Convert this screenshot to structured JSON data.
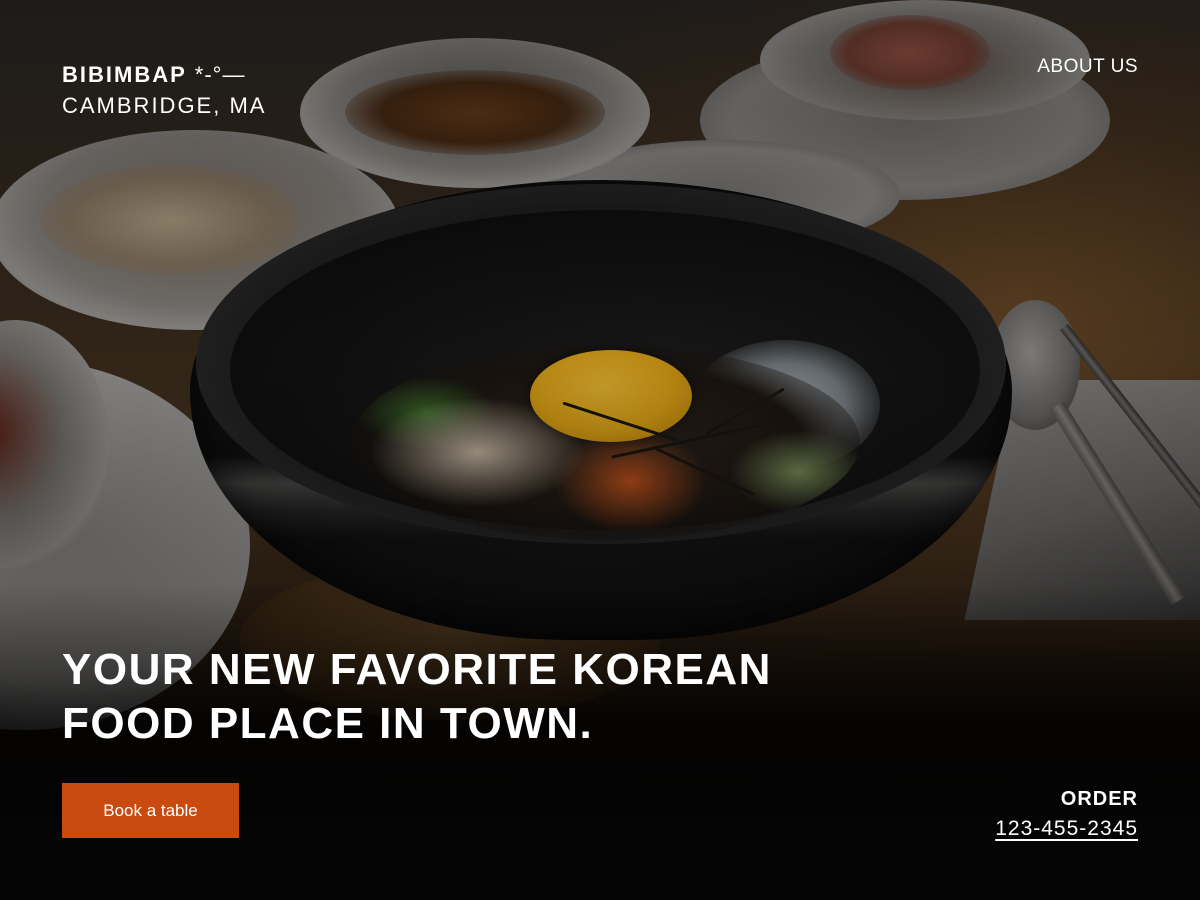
{
  "brand": {
    "name": "BIBIMBAP",
    "glyph": "*-°—",
    "location": "CAMBRIDGE, MA"
  },
  "nav": {
    "about_label": "ABOUT US"
  },
  "hero": {
    "headline_line1": "YOUR NEW FAVORITE KOREAN",
    "headline_line2": "FOOD PLACE IN TOWN.",
    "cta_label": "Book a table"
  },
  "order": {
    "label": "ORDER",
    "phone": "123-455-2345"
  },
  "colors": {
    "accent": "#c94a0e",
    "text": "#ffffff",
    "background_bottom": "#050505"
  }
}
